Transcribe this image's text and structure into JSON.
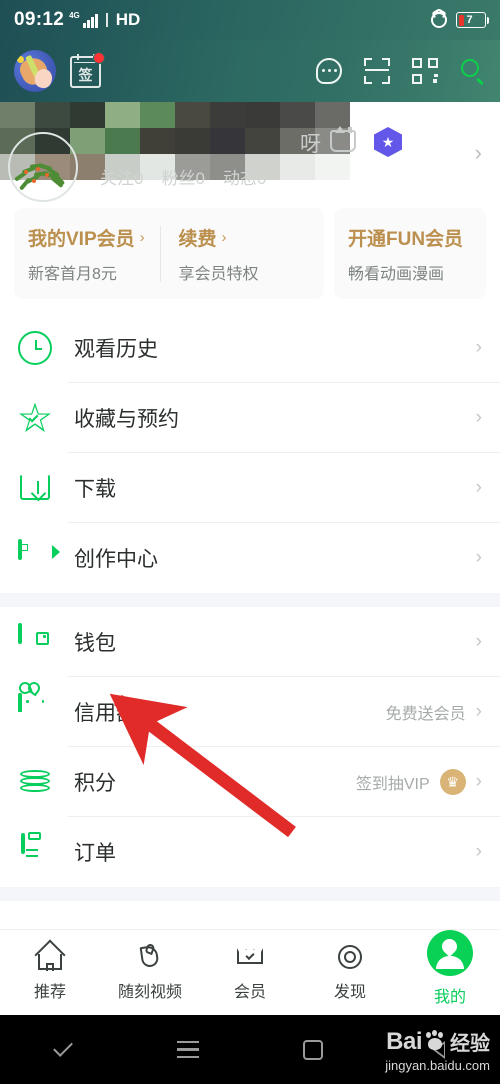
{
  "status_bar": {
    "time": "09:12",
    "network_type": "4G",
    "hd_label": "HD",
    "alarm_icon": "alarm-clock-icon",
    "battery_level": "7"
  },
  "app_bar": {
    "avatar_icon": "user-avatar-icon",
    "signin_label": "签",
    "signin_has_badge": true,
    "actions": [
      {
        "name": "message-icon",
        "label": "消息"
      },
      {
        "name": "scan-icon",
        "label": "扫一扫"
      },
      {
        "name": "qrcode-icon",
        "label": "二维码"
      },
      {
        "name": "search-icon",
        "label": "搜索"
      }
    ],
    "accent_green": "#0ad04a"
  },
  "profile": {
    "name_fragment": "呀",
    "level_badge_icon": "crown-level-badge-icon",
    "vip_badge_icon": "hexagon-star-badge-icon",
    "chevron": "›",
    "stats": [
      {
        "label": "关注",
        "value": "0"
      },
      {
        "label": "粉丝",
        "value": "0"
      },
      {
        "label": "动态",
        "value": "0"
      }
    ],
    "censored": true
  },
  "vip_cards": [
    {
      "title": "我的VIP会员",
      "chevron": "›",
      "subtitle": "新客首月8元"
    },
    {
      "title": "续费",
      "chevron": "›",
      "subtitle": "享会员特权"
    },
    {
      "title": "开通FUN会员",
      "chevron": "",
      "subtitle": "畅看动画漫画"
    }
  ],
  "menu_sections": [
    {
      "items": [
        {
          "icon": "clock-icon",
          "label": "观看历史",
          "right_text": "",
          "chevron": "›"
        },
        {
          "icon": "star-icon",
          "label": "收藏与预约",
          "right_text": "",
          "chevron": "›"
        },
        {
          "icon": "download-icon",
          "label": "下载",
          "right_text": "",
          "chevron": "›"
        },
        {
          "icon": "video-camera-icon",
          "label": "创作中心",
          "right_text": "",
          "chevron": "›"
        }
      ]
    },
    {
      "items": [
        {
          "icon": "wallet-icon",
          "label": "钱包",
          "right_text": "",
          "chevron": "›",
          "highlighted": true
        },
        {
          "icon": "credit-rabbit-icon",
          "label": "信用额度",
          "right_text": "免费送会员",
          "chevron": "›"
        },
        {
          "icon": "points-coins-icon",
          "label": "积分",
          "right_text": "签到抽VIP",
          "badge": "crown-badge-icon",
          "chevron": "›"
        },
        {
          "icon": "order-clipboard-icon",
          "label": "订单",
          "right_text": "",
          "chevron": "›"
        }
      ]
    }
  ],
  "annotation": {
    "type": "arrow",
    "color": "#e02b28",
    "points_to": "钱包"
  },
  "tab_bar": {
    "tabs": [
      {
        "icon": "home-icon",
        "label": "推荐",
        "active": false
      },
      {
        "icon": "flame-icon",
        "label": "随刻视频",
        "active": false
      },
      {
        "icon": "crown-icon",
        "label": "会员",
        "active": false
      },
      {
        "icon": "discover-circle-icon",
        "label": "发现",
        "active": false
      },
      {
        "icon": "profile-avatar-icon",
        "label": "我的",
        "active": true
      }
    ],
    "active_color": "#07ce5c"
  },
  "android_nav": {
    "buttons": [
      "collapse-icon",
      "menu-icon",
      "home-square-icon",
      "back-icon"
    ]
  },
  "watermark": {
    "brand": "Bai",
    "suffix": "经验",
    "url": "jingyan.baidu.com"
  }
}
